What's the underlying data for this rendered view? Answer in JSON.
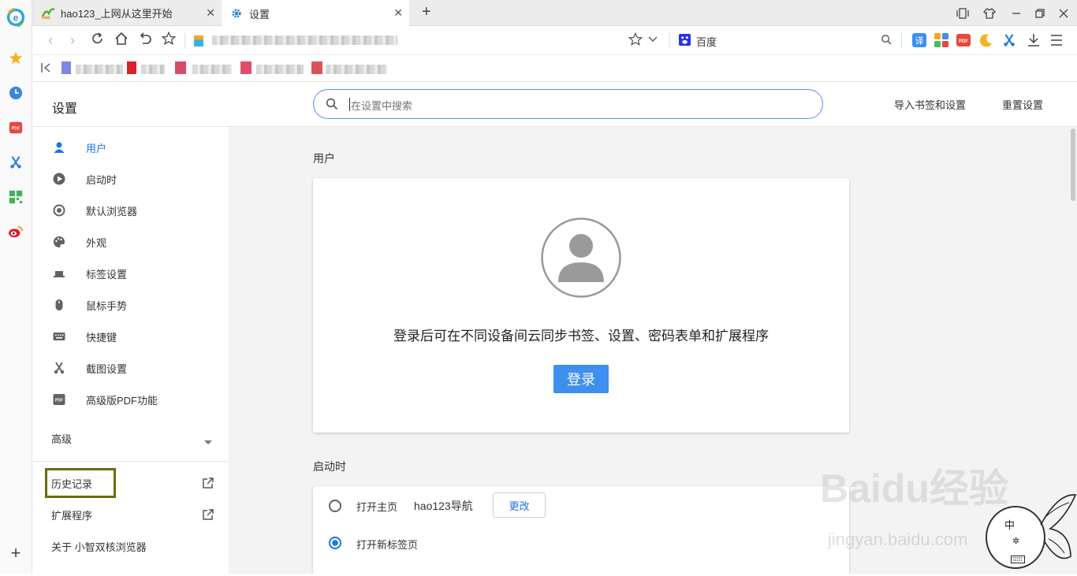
{
  "tabs": [
    {
      "title": "hao123_上网从这里开始",
      "favicon": "hao-icon",
      "close": "✕"
    },
    {
      "title": "设置",
      "favicon": "gear-icon",
      "close": "✕"
    }
  ],
  "new_tab": "+",
  "address": {
    "search_engine": "百度"
  },
  "header": {
    "title": "设置",
    "search_placeholder": "在设置中搜索",
    "import_label": "导入书签和设置",
    "reset_label": "重置设置"
  },
  "sidebar": {
    "items": [
      {
        "label": "用户",
        "icon": "person-icon",
        "active": true
      },
      {
        "label": "启动时",
        "icon": "play-icon"
      },
      {
        "label": "默认浏览器",
        "icon": "target-icon"
      },
      {
        "label": "外观",
        "icon": "palette-icon"
      },
      {
        "label": "标签设置",
        "icon": "tab-icon"
      },
      {
        "label": "鼠标手势",
        "icon": "mouse-icon"
      },
      {
        "label": "快捷键",
        "icon": "keyboard-icon"
      },
      {
        "label": "截图设置",
        "icon": "scissors-icon"
      },
      {
        "label": "高级版PDF功能",
        "icon": "pdf-icon"
      }
    ],
    "advanced": "高级",
    "links": [
      {
        "label": "历史记录",
        "highlighted": true
      },
      {
        "label": "扩展程序"
      }
    ],
    "about": "关于 小智双核浏览器"
  },
  "main": {
    "user_section_title": "用户",
    "sync_text": "登录后可在不同设备间云同步书签、设置、密码表单和扩展程序",
    "login_button": "登录",
    "startup_section_title": "启动时",
    "startup_options": [
      {
        "label": "打开主页",
        "value": "hao123导航",
        "button": "更改",
        "selected": false
      },
      {
        "label": "打开新标签页",
        "selected": true
      }
    ]
  },
  "watermark": {
    "main": "Baidu经验",
    "sub": "jingyan.baidu.com"
  },
  "ime": {
    "label": "中"
  },
  "colors": {
    "accent": "#1a73e8",
    "login_bg": "#3d8ff0",
    "highlight_border": "#6b6b10"
  }
}
